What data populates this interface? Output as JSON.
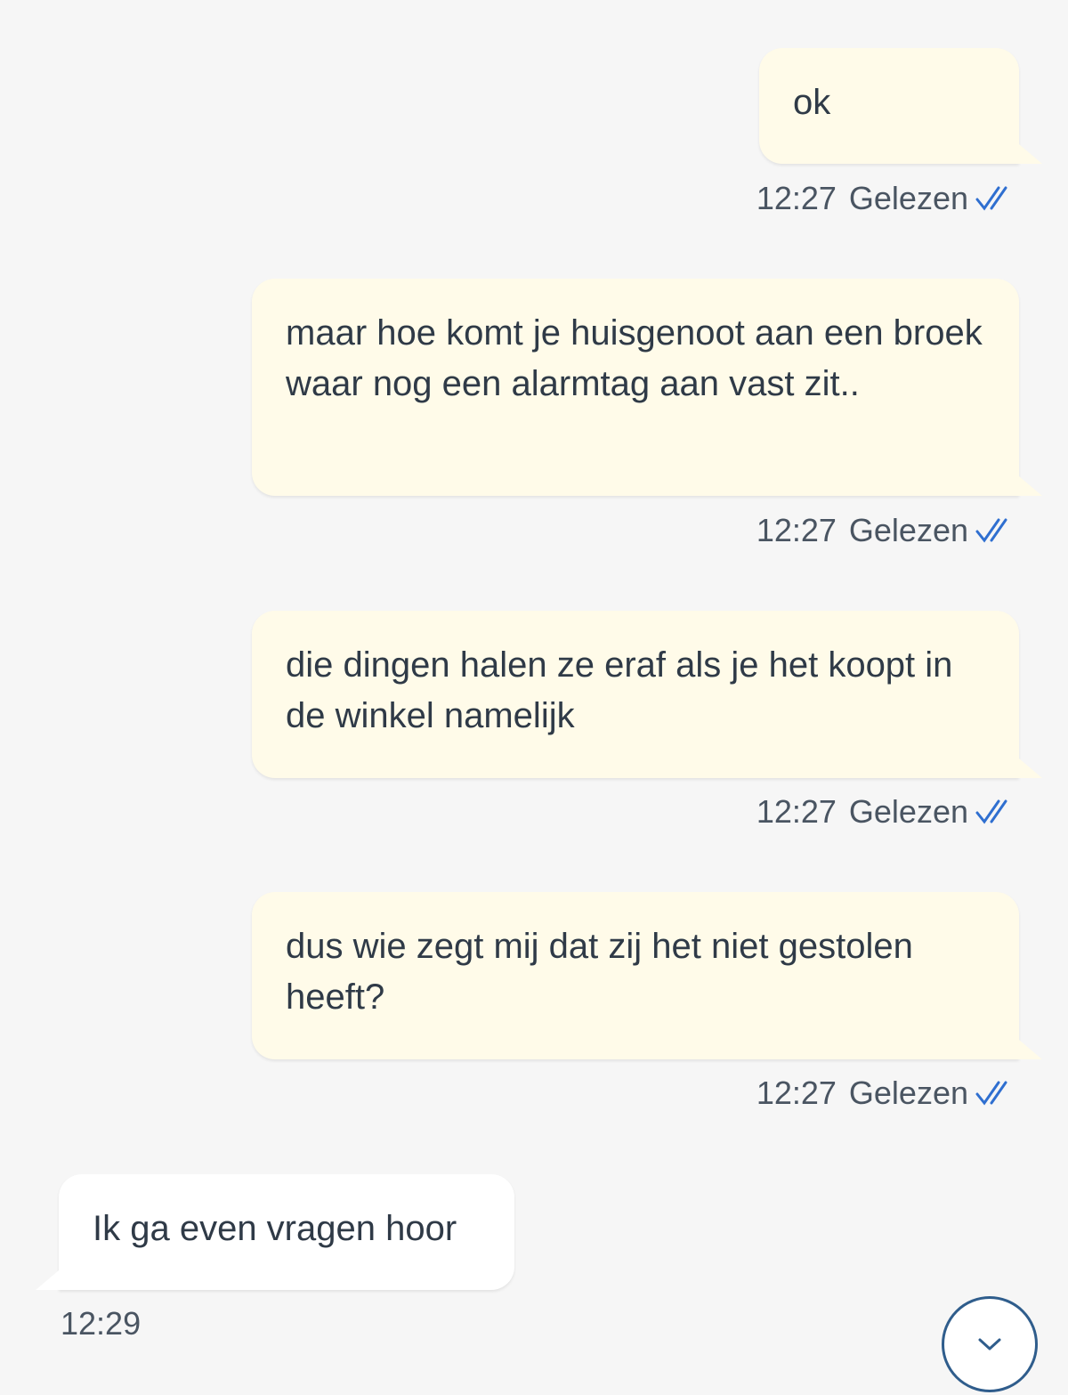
{
  "messages": [
    {
      "direction": "out",
      "text": "ok",
      "time": "12:27",
      "status": "Gelezen"
    },
    {
      "direction": "out",
      "text": "maar hoe komt je huisgenoot aan een broek waar nog een alarmtag aan vast zit..",
      "time": "12:27",
      "status": "Gelezen"
    },
    {
      "direction": "out",
      "text": "die dingen halen ze eraf als je het koopt in de winkel namelijk",
      "time": "12:27",
      "status": "Gelezen"
    },
    {
      "direction": "out",
      "text": "dus wie zegt mij dat zij het niet gestolen heeft?",
      "time": "12:27",
      "status": "Gelezen"
    },
    {
      "direction": "in",
      "text": "Ik ga even vragen hoor",
      "time": "12:29"
    }
  ],
  "colors": {
    "background": "#f6f6f6",
    "outgoing_bubble": "#fffbe9",
    "incoming_bubble": "#ffffff",
    "read_check": "#2f6fd0",
    "scroll_button_border": "#2f5d8c"
  },
  "icons": {
    "read_receipt": "double-check-icon",
    "scroll_down": "chevron-down-icon"
  }
}
